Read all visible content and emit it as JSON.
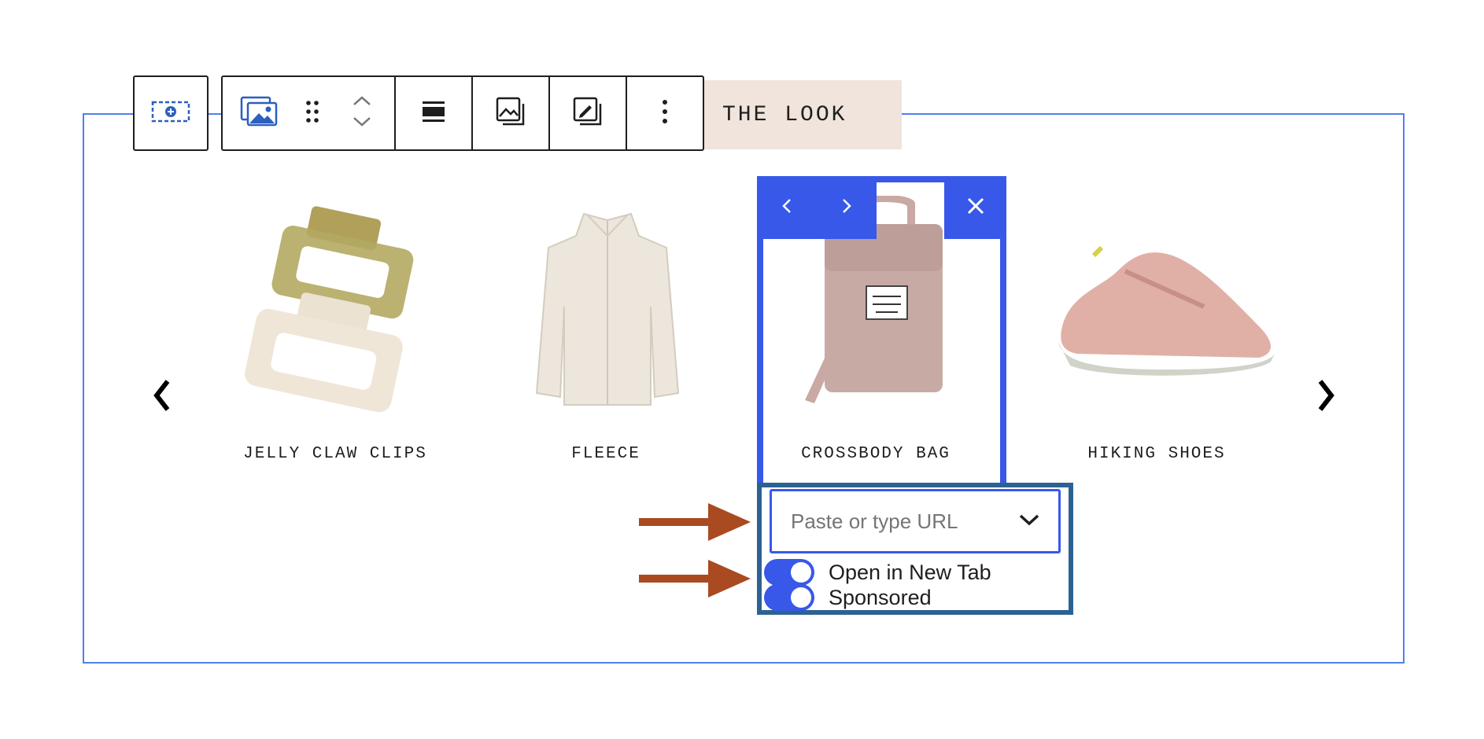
{
  "heading": {
    "text": "THE LOOK"
  },
  "toolbar": {
    "icons": [
      "add-block-icon",
      "gallery-icon",
      "drag-handle-icon",
      "chevron-up-icon",
      "chevron-down-icon",
      "align-icon",
      "media-icon",
      "edit-media-icon",
      "more-options-icon"
    ]
  },
  "carousel": {
    "products": [
      {
        "label": "JELLY CLAW CLIPS"
      },
      {
        "label": "FLEECE"
      },
      {
        "label": "CROSSBODY BAG",
        "selected": true
      },
      {
        "label": "HIKING SHOES"
      }
    ]
  },
  "link_popover": {
    "url_placeholder": "Paste or type URL",
    "url_value": "",
    "toggles": [
      {
        "label": "Open in New Tab",
        "checked": true
      },
      {
        "label": "Sponsored",
        "checked": true
      }
    ]
  },
  "colors": {
    "accent": "#3858e9",
    "block_outline": "#4f7ff0",
    "popover_border": "#2c6293",
    "annotation_arrow": "#a94a21",
    "heading_bg": "#f0e4dc"
  }
}
